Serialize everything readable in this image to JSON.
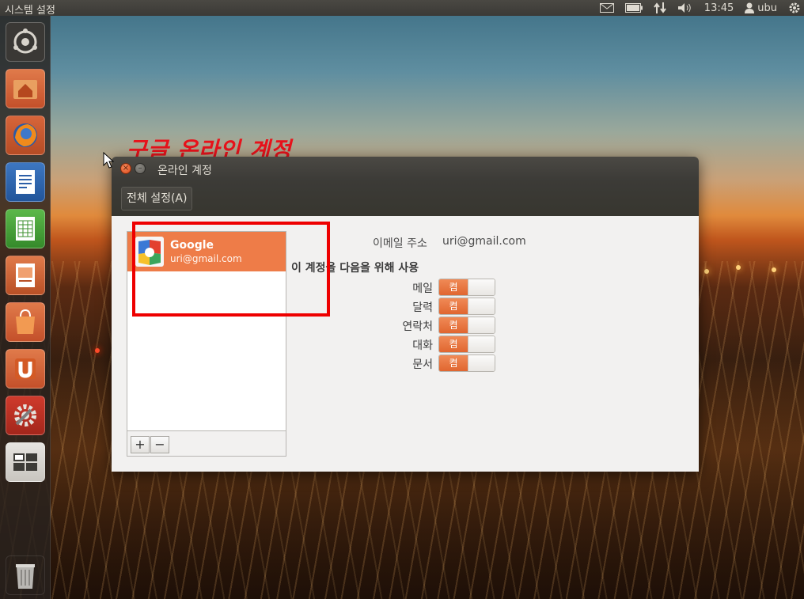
{
  "panel": {
    "app_title": "시스템 설정",
    "time": "13:45",
    "user": "ubu",
    "icons": [
      "mail-icon",
      "battery-icon",
      "network-icon",
      "volume-icon",
      "user-icon",
      "gear-icon"
    ]
  },
  "launcher": {
    "items": [
      "dash-icon",
      "home-folder-icon",
      "firefox-icon",
      "writer-icon",
      "calc-icon",
      "impress-icon",
      "software-center-icon",
      "ubuntu-one-icon",
      "system-settings-icon",
      "workspace-switcher-icon",
      "trash-icon"
    ]
  },
  "annotation": {
    "text": "구글 온라인 계정"
  },
  "window": {
    "title": "온라인 계정",
    "toolbar_button": "전체 설정(A)",
    "account": {
      "provider": "Google",
      "email": "uri@gmail.com"
    },
    "list_buttons": {
      "add": "+",
      "remove": "−"
    },
    "email_label": "이메일 주소",
    "email_value": "uri@gmail.com",
    "use_heading": "이 계정을 다음을 위해 사용",
    "services": [
      {
        "label": "메일",
        "state": "켬"
      },
      {
        "label": "달력",
        "state": "켬"
      },
      {
        "label": "연락처",
        "state": "켬"
      },
      {
        "label": "대화",
        "state": "켬"
      },
      {
        "label": "문서",
        "state": "켬"
      }
    ]
  },
  "colors": {
    "accent": "#ee7c48",
    "annotation_red": "#e8121b",
    "panel_bg": "#3c3b37"
  }
}
